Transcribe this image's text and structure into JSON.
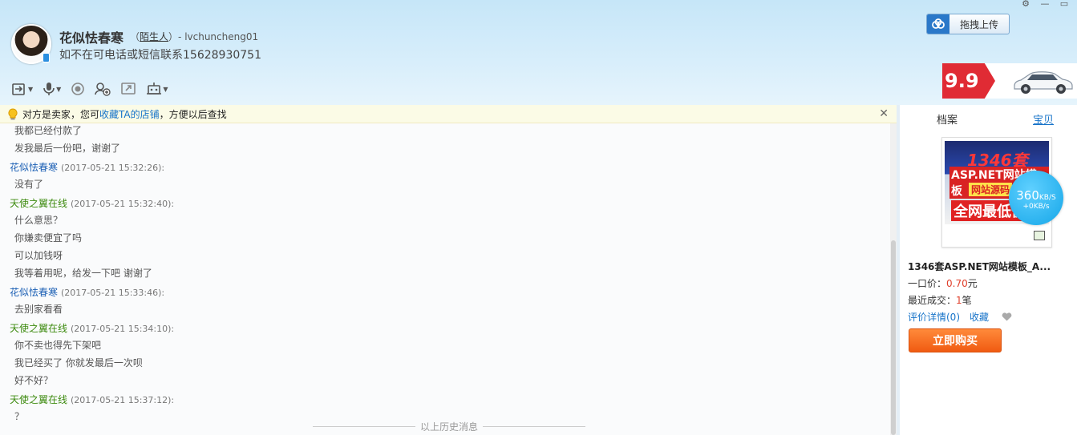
{
  "contact": {
    "name": "花似怯春寒",
    "relation_open": "（",
    "relation_tag": "陌生人",
    "relation_close": "）",
    "user_id": "- lvchuncheng01",
    "signature": "如不在可电话或短信联系15628930751"
  },
  "toolbar": {
    "items": [
      "file-transfer-icon",
      "voice-icon",
      "record-icon",
      "add-person-icon",
      "share-screen-icon",
      "robot-icon"
    ]
  },
  "upload_button": {
    "label": "拖拽上传"
  },
  "ad": {
    "price": "9.9起"
  },
  "window_controls": [
    "settings-icon",
    "minimize-icon",
    "maximize-icon"
  ],
  "notice": {
    "prefix": "对方是卖家，您可",
    "link": "收藏TA的店铺",
    "suffix": "，方便以后查找"
  },
  "chat": {
    "lines_top": [
      "我都已经付款了",
      "发我最后一份吧，谢谢了"
    ],
    "messages": [
      {
        "sender": "花似怯春寒",
        "time": "(2017-05-21 15:32:26):",
        "color": "blue",
        "lines": [
          "没有了"
        ]
      },
      {
        "sender": "天使之翼在线",
        "time": "(2017-05-21 15:32:40):",
        "color": "green",
        "lines": [
          "什么意思？",
          "你嫌卖便宜了吗",
          "可以加钱呀",
          "我等着用呢，给发一下吧 谢谢了"
        ]
      },
      {
        "sender": "花似怯春寒",
        "time": "(2017-05-21 15:33:46):",
        "color": "blue",
        "lines": [
          "去别家看看"
        ]
      },
      {
        "sender": "天使之翼在线",
        "time": "(2017-05-21 15:34:10):",
        "color": "green",
        "lines": [
          "你不卖也得先下架吧",
          "我已经买了 你就发最后一次呗",
          "好不好？"
        ]
      },
      {
        "sender": "天使之翼在线",
        "time": "(2017-05-21 15:37:12):",
        "color": "green",
        "lines": [
          "？"
        ]
      }
    ],
    "history_label": "以上历史消息"
  },
  "panel": {
    "tabs": [
      "档案",
      "宝贝"
    ],
    "thumb_text": {
      "t1": "1346套",
      "t2": "ASP.NET网站模板",
      "t3": "网站源码",
      "t4": "全网最低价"
    },
    "speed": {
      "value": "360",
      "unit": "KB/S",
      "sub": "+0KB/s"
    },
    "item_title": "1346套ASP.NET网站模板_A...",
    "price_label": "一口价：",
    "price_value": "0.70",
    "price_unit": "元",
    "sold_label": "最近成交：",
    "sold_value": "1",
    "sold_unit": "笔",
    "review_link": "评价详情(0)",
    "fav_link": "收藏",
    "buy_label": "立即购买"
  }
}
